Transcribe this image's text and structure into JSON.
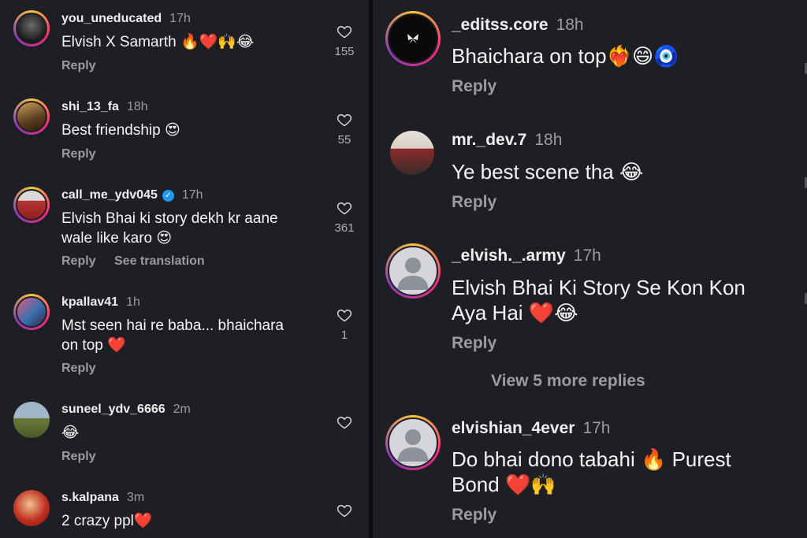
{
  "left_comments": [
    {
      "username": "you_uneducated",
      "time": "17h",
      "lines": [
        "Elvish X Samarth 🔥❤️🙌😂"
      ],
      "reply": "Reply",
      "likes": "155"
    },
    {
      "username": "shi_13_fa",
      "time": "18h",
      "lines": [
        "Best friendship 😍"
      ],
      "reply": "Reply",
      "likes": "55"
    },
    {
      "username": "call_me_ydv045",
      "time": "17h",
      "verified": true,
      "lines": [
        "Elvish Bhai ki story dekh kr aane",
        "wale like karo 😍"
      ],
      "reply": "Reply",
      "see_translation": "See translation",
      "likes": "361"
    },
    {
      "username": "kpallav41",
      "time": "1h",
      "lines": [
        "Mst seen hai re baba... bhaichara",
        "on top ❤️"
      ],
      "reply": "Reply",
      "likes": "1"
    },
    {
      "username": "suneel_ydv_6666",
      "time": "2m",
      "lines": [
        "😂"
      ],
      "reply": "Reply",
      "likes": ""
    },
    {
      "username": "s.kalpana",
      "time": "3m",
      "lines": [
        "2 crazy ppl❤️"
      ],
      "reply": "",
      "likes": ""
    }
  ],
  "right_comments": [
    {
      "username": "_editss.core",
      "time": "18h",
      "lines": [
        "Bhaichara on top❤️‍🔥😄🧿"
      ],
      "reply": "Reply"
    },
    {
      "username": "mr._dev.7",
      "time": "18h",
      "lines": [
        "Ye best scene tha 😂"
      ],
      "reply": "Reply"
    },
    {
      "username": "_elvish._.army",
      "time": "17h",
      "lines": [
        "Elvish Bhai Ki Story Se Kon Kon",
        "Aya Hai ❤️😂"
      ],
      "reply": "Reply"
    },
    {
      "username": "elvishian_4ever",
      "time": "17h",
      "lines": [
        "Do bhai dono tabahi 🔥 Purest",
        "Bond ❤️🙌"
      ],
      "reply": "Reply"
    }
  ],
  "view_more_replies": "View 5 more replies",
  "colors": {
    "background": "#1e1f24",
    "text": "#f4f4f4",
    "muted": "#9a9ca3",
    "verified": "#1d9bf0"
  },
  "icons": {
    "like": "heart-outline-icon",
    "verified": "verified-badge-icon",
    "default_avatar": "person-silhouette-icon"
  }
}
